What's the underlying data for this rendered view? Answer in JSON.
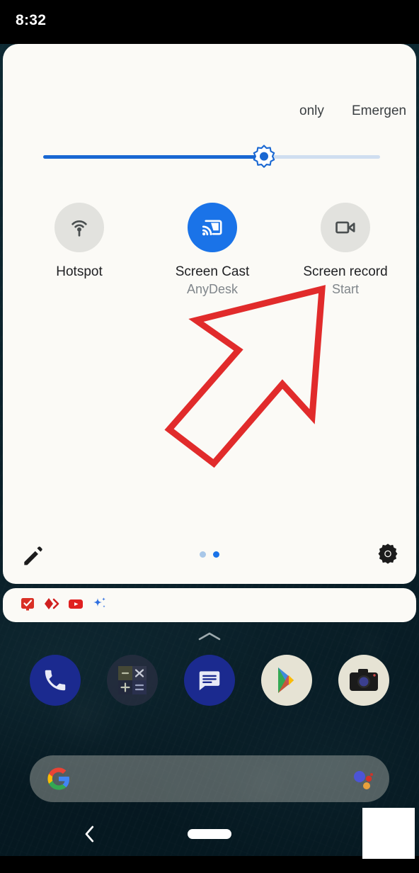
{
  "status_bar": {
    "time": "8:32"
  },
  "quick_settings": {
    "carrier_text_left": "only",
    "carrier_text_right": "Emergen",
    "brightness": {
      "icon": "brightness-sun-icon",
      "value_percent": 66,
      "fill_color": "#1967d2",
      "track_color": "#cfdef0"
    },
    "tiles": [
      {
        "id": "hotspot",
        "label": "Hotspot",
        "subtitle": "",
        "icon": "wifi-tethering-icon",
        "state": "off",
        "bg_color": "#e2e2de"
      },
      {
        "id": "screen-cast",
        "label": "Screen Cast",
        "subtitle": "AnyDesk",
        "icon": "cast-icon",
        "state": "on",
        "bg_color": "#1a73e8"
      },
      {
        "id": "screen-record",
        "label": "Screen record",
        "subtitle": "Start",
        "icon": "videocam-icon",
        "state": "off",
        "bg_color": "#e2e2de"
      }
    ],
    "footer": {
      "edit_icon": "pencil-edit-icon",
      "settings_icon": "gear-icon",
      "page_count": 2,
      "active_page": 2
    },
    "panel_bg_color": "#fbfaf6"
  },
  "annotation": {
    "type": "arrow",
    "color": "#e12b2b",
    "points_to": "screen-record",
    "direction": "up-right"
  },
  "notification_shelf": {
    "icons": [
      {
        "name": "tasks-checkbox-icon",
        "color": "#d93025"
      },
      {
        "name": "anydesk-icon",
        "color": "#d02020"
      },
      {
        "name": "youtube-icon",
        "color": "#e02020"
      },
      {
        "name": "gemini-sparkle-icon",
        "color": "#2f6fe0"
      }
    ]
  },
  "home_screen": {
    "drawer_handle_icon": "chevron-up-icon",
    "dock": [
      {
        "name": "phone-app",
        "label": "Phone",
        "icon": "phone-icon",
        "bg_color": "#1b2a8f"
      },
      {
        "name": "calculator-app",
        "label": "Calculator",
        "icon": "calculator-icon",
        "bg_color": "#2a2f42"
      },
      {
        "name": "messages-app",
        "label": "Messages",
        "icon": "messages-icon",
        "bg_color": "#1b2a8f"
      },
      {
        "name": "play-store-app",
        "label": "Play Store",
        "icon": "play-store-icon",
        "bg_color": "#e6e3d4"
      },
      {
        "name": "camera-app",
        "label": "Camera",
        "icon": "camera-icon",
        "bg_color": "#e6e3d4"
      }
    ],
    "search_bar": {
      "logo_icon": "google-g-icon",
      "assistant_icon": "google-assistant-icon",
      "placeholder": ""
    }
  },
  "navigation_bar": {
    "back_icon": "chevron-left-icon",
    "home_icon": "home-pill-icon"
  }
}
